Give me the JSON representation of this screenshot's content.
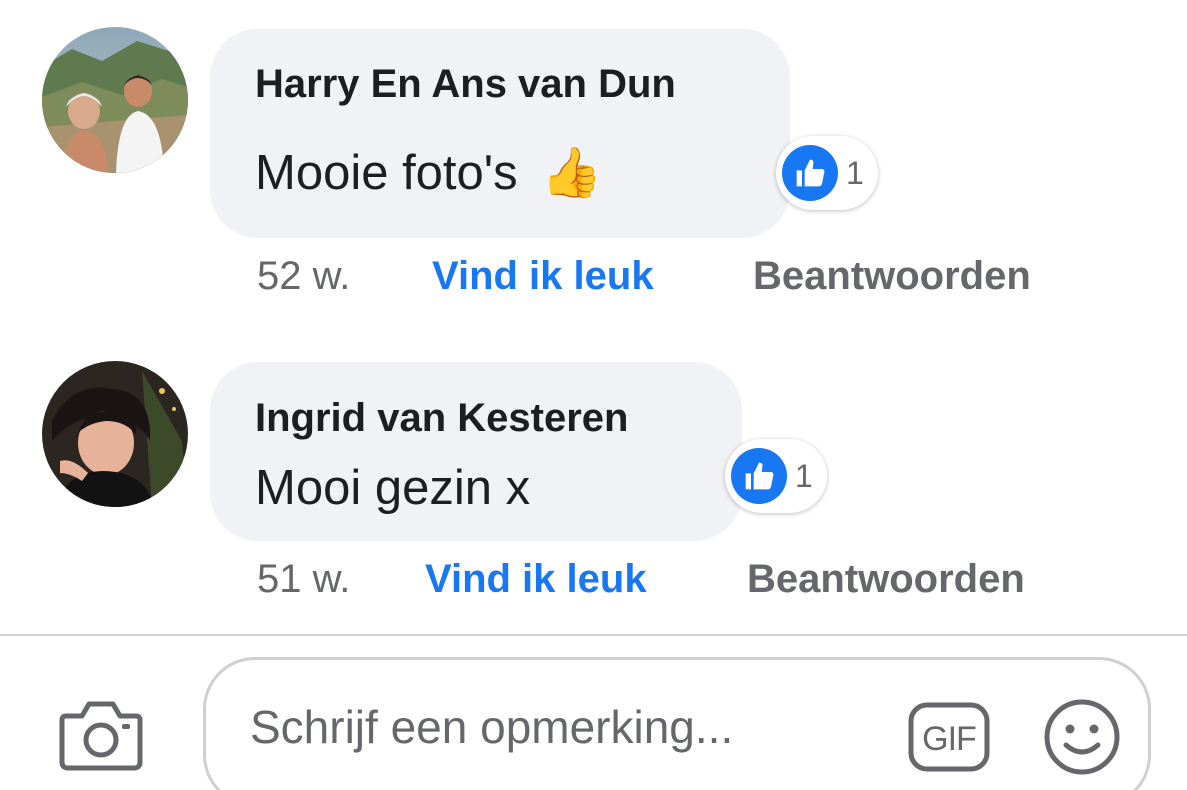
{
  "comments": [
    {
      "author": "Harry En Ans van Dun",
      "text": "Mooie foto's",
      "emoji": "👍",
      "reaction_count": "1",
      "time": "52 w.",
      "like_label": "Vind ik leuk",
      "reply_label": "Beantwoorden"
    },
    {
      "author": "Ingrid van Kesteren",
      "text": "Mooi gezin x",
      "reaction_count": "1",
      "time": "51 w.",
      "like_label": "Vind ik leuk",
      "reply_label": "Beantwoorden"
    }
  ],
  "composer": {
    "placeholder": "Schrijf een opmerking...",
    "gif_label": "GIF"
  },
  "icons": {
    "camera": "camera-icon",
    "gif": "gif-icon",
    "emoji": "emoji-icon",
    "like": "like-icon"
  },
  "colors": {
    "accent": "#1877f2",
    "bubble": "#f0f2f5",
    "secondary_text": "#65676b",
    "primary_text": "#1c1e21"
  }
}
